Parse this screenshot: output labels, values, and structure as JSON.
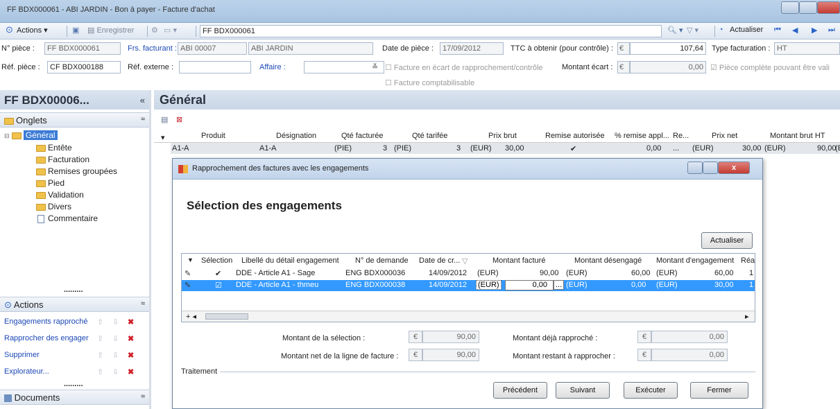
{
  "window": {
    "title": "FF BDX000061 - ABI JARDIN - Bon à payer - Facture d'achat"
  },
  "toolbar": {
    "actions": "Actions",
    "save": "Enregistrer",
    "doc_id": "FF BDX000061",
    "refresh": "Actualiser"
  },
  "header": {
    "num_piece_label": "N° pièce :",
    "num_piece": "FF BDX000061",
    "frs_label": "Frs. facturant :",
    "frs_code": "ABI 00007",
    "frs_name": "ABI JARDIN",
    "date_label": "Date de pièce :",
    "date": "17/09/2012",
    "ttc_label": "TTC à obtenir (pour contrôle) :",
    "ttc_cur": "€",
    "ttc": "107,64",
    "type_label": "Type facturation :",
    "type": "HT",
    "ref_label": "Réf. pièce :",
    "ref": "CF BDX000188",
    "ext_label": "Réf. externe :",
    "ext": "",
    "affaire_label": "Affaire :",
    "affaire": "",
    "ecart_chk": "Facture en écart de rapprochement/contrôle",
    "ecart_label": "Montant écart :",
    "ecart_cur": "€",
    "ecart": "0,00",
    "complete_chk": "Pièce complète pouvant être vali",
    "compta_chk": "Facture comptabilisable"
  },
  "left": {
    "title": "FF BDX00006...",
    "collapse": "«",
    "onglets": "Onglets",
    "tree": [
      "Général",
      "Entête",
      "Facturation",
      "Remises groupées",
      "Pied",
      "Validation",
      "Divers",
      "Commentaire"
    ],
    "actions_title": "Actions",
    "actions": [
      "Engagements rapproché",
      "Rapprocher des engager",
      "Supprimer",
      "Explorateur..."
    ],
    "documents": "Documents",
    "dots": "........."
  },
  "main": {
    "title": "Général",
    "columns": [
      "Produit",
      "Désignation",
      "Qté facturée",
      "Qté tarifée",
      "Prix brut",
      "Remise autorisée",
      "% remise appl...",
      "Re...",
      "Prix net",
      "Montant brut HT"
    ],
    "row": [
      "A1-A",
      "A1-A",
      "(PIE)",
      "3",
      "(PIE)",
      "3",
      "(EUR)",
      "30,00",
      "✔",
      "0,00",
      "...",
      "(EUR)",
      "30,00",
      "(EUR)",
      "90,00",
      "(E"
    ]
  },
  "dialog": {
    "title": "Rapprochement des factures avec les engagements",
    "heading": "Sélection des engagements",
    "refresh": "Actualiser",
    "columns": [
      "Sélection",
      "Libellé du détail engagement",
      "N° de demande",
      "Date de cr...",
      "Montant facturé",
      "Montant désengagé",
      "Montant d'engagement",
      "Réa"
    ],
    "rows": [
      {
        "sel": "✔",
        "libelle": "DDE - Article A1 - Sage",
        "demande": "ENG BDX000036",
        "date": "14/09/2012",
        "cur1": "(EUR)",
        "facture": "90,00",
        "cur2": "(EUR)",
        "desengage": "60,00",
        "cur3": "(EUR)",
        "engagement": "60,00",
        "rea": "1"
      },
      {
        "sel": "☑",
        "libelle": "DDE - Article A1 - thmeu",
        "demande": "ENG BDX000038",
        "date": "14/09/2012",
        "cur1": "(EUR)",
        "facture": "0,00",
        "cur2": "(EUR)",
        "desengage": "0,00",
        "cur3": "(EUR)",
        "engagement": "30,00",
        "rea": "1"
      }
    ],
    "totals": {
      "selection_label": "Montant de la sélection :",
      "selection": "90,00",
      "net_label": "Montant net de la ligne de facture :",
      "net": "90,00",
      "deja_label": "Montant déjà rapproché :",
      "deja": "0,00",
      "restant_label": "Montant restant à rapprocher :",
      "restant": "0,00",
      "cur": "€"
    },
    "traitement": "Traitement",
    "buttons": {
      "prev": "Précédent",
      "next": "Suivant",
      "exec": "Exécuter",
      "close": "Fermer"
    }
  }
}
